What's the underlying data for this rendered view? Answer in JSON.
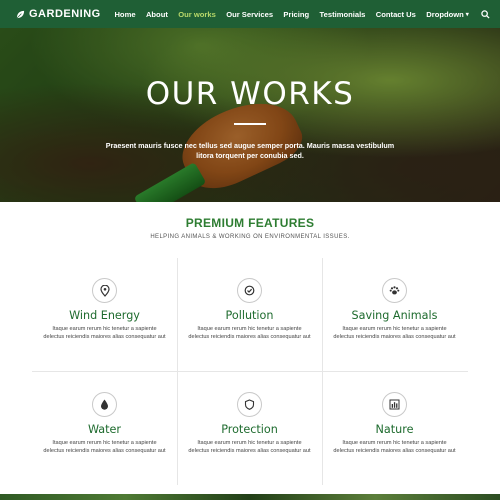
{
  "header": {
    "brand": "GARDENING",
    "nav": [
      {
        "label": "Home",
        "active": false
      },
      {
        "label": "About",
        "active": false
      },
      {
        "label": "Our works",
        "active": true
      },
      {
        "label": "Our Services",
        "active": false
      },
      {
        "label": "Pricing",
        "active": false
      },
      {
        "label": "Testimonials",
        "active": false
      },
      {
        "label": "Contact Us",
        "active": false
      }
    ],
    "dropdown_label": "Dropdown",
    "colors": {
      "bar": "#1f5f35",
      "active": "#b8d86a"
    }
  },
  "hero": {
    "title": "OUR WORKS",
    "text": "Praesent mauris fusce nec tellus sed augue semper porta. Mauris massa vestibulum litora torquent per conubia sed."
  },
  "features": {
    "title": "PREMIUM FEATURES",
    "subtitle": "HELPING ANIMALS & WORKING ON ENVIRONMENTAL ISSUES.",
    "items": [
      {
        "title": "Wind Energy",
        "icon": "location-pin-icon",
        "text": "Itaque earum rerum hic tenetur a sapiente delectus reiciendis maiores alias consequatur aut"
      },
      {
        "title": "Pollution",
        "icon": "check-circle-icon",
        "text": "Itaque earum rerum hic tenetur a sapiente delectus reiciendis maiores alias consequatur aut"
      },
      {
        "title": "Saving Animals",
        "icon": "paw-icon",
        "text": "Itaque earum rerum hic tenetur a sapiente delectus reiciendis maiores alias consequatur aut"
      },
      {
        "title": "Water",
        "icon": "water-drop-icon",
        "text": "Itaque earum rerum hic tenetur a sapiente delectus reiciendis maiores alias consequatur aut"
      },
      {
        "title": "Protection",
        "icon": "shield-icon",
        "text": "Itaque earum rerum hic tenetur a sapiente delectus reiciendis maiores alias consequatur aut"
      },
      {
        "title": "Nature",
        "icon": "bar-chart-icon",
        "text": "Itaque earum rerum hic tenetur a sapiente delectus reiciendis maiores alias consequatur aut"
      }
    ]
  }
}
